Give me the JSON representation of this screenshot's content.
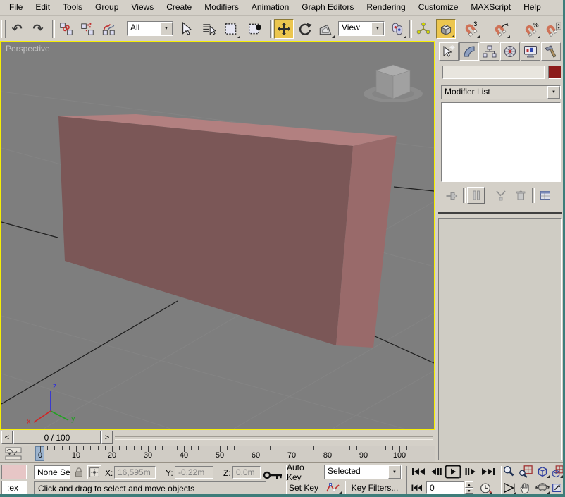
{
  "menu_bar": {
    "items": [
      "File",
      "Edit",
      "Tools",
      "Group",
      "Views",
      "Create",
      "Modifiers",
      "Animation",
      "Graph Editors",
      "Rendering",
      "Customize",
      "MAXScript",
      "Help"
    ]
  },
  "toolbar": {
    "selection_filter_value": "All",
    "reference_coordinate_value": "View"
  },
  "viewport": {
    "label": "Perspective"
  },
  "command_panel": {
    "object_name_value": "",
    "modifier_list_label": "Modifier List"
  },
  "time_controls": {
    "time_slider_value": "0 / 100",
    "prev_frame_arrow": "<",
    "next_frame_arrow": ">",
    "auto_key_label": "Auto Key",
    "set_key_label": "Set Key",
    "key_scope_value": "Selected",
    "key_filters_label": "Key Filters...",
    "frame_field_value": "0"
  },
  "track_bar": {
    "tick_labels": [
      "0",
      "10",
      "20",
      "30",
      "40",
      "50",
      "60",
      "70",
      "80",
      "90",
      "100"
    ]
  },
  "status_bar": {
    "listener_text": ":ex",
    "selection_status": "None Se",
    "x_label": "X:",
    "x_value": "16,595m",
    "y_label": "Y:",
    "y_value": "-0,22m",
    "z_label": "Z:",
    "z_value": "0,0m",
    "prompt": "Click and drag to select and move objects"
  },
  "axis_tripod": {
    "x": "x",
    "y": "y",
    "z": "z"
  },
  "colors": {
    "ui_gray": "#d4d0c8",
    "viewport_background": "#7e7e7e",
    "active_viewport_border": "#f6ee04",
    "active_button_highlight": "#ecc64f",
    "box_top": "#b28080",
    "box_front": "#7b5757",
    "box_side": "#996a6a",
    "object_color_swatch": "#8c1a1a",
    "macro_recorder_pink": "#e7c6c6"
  }
}
